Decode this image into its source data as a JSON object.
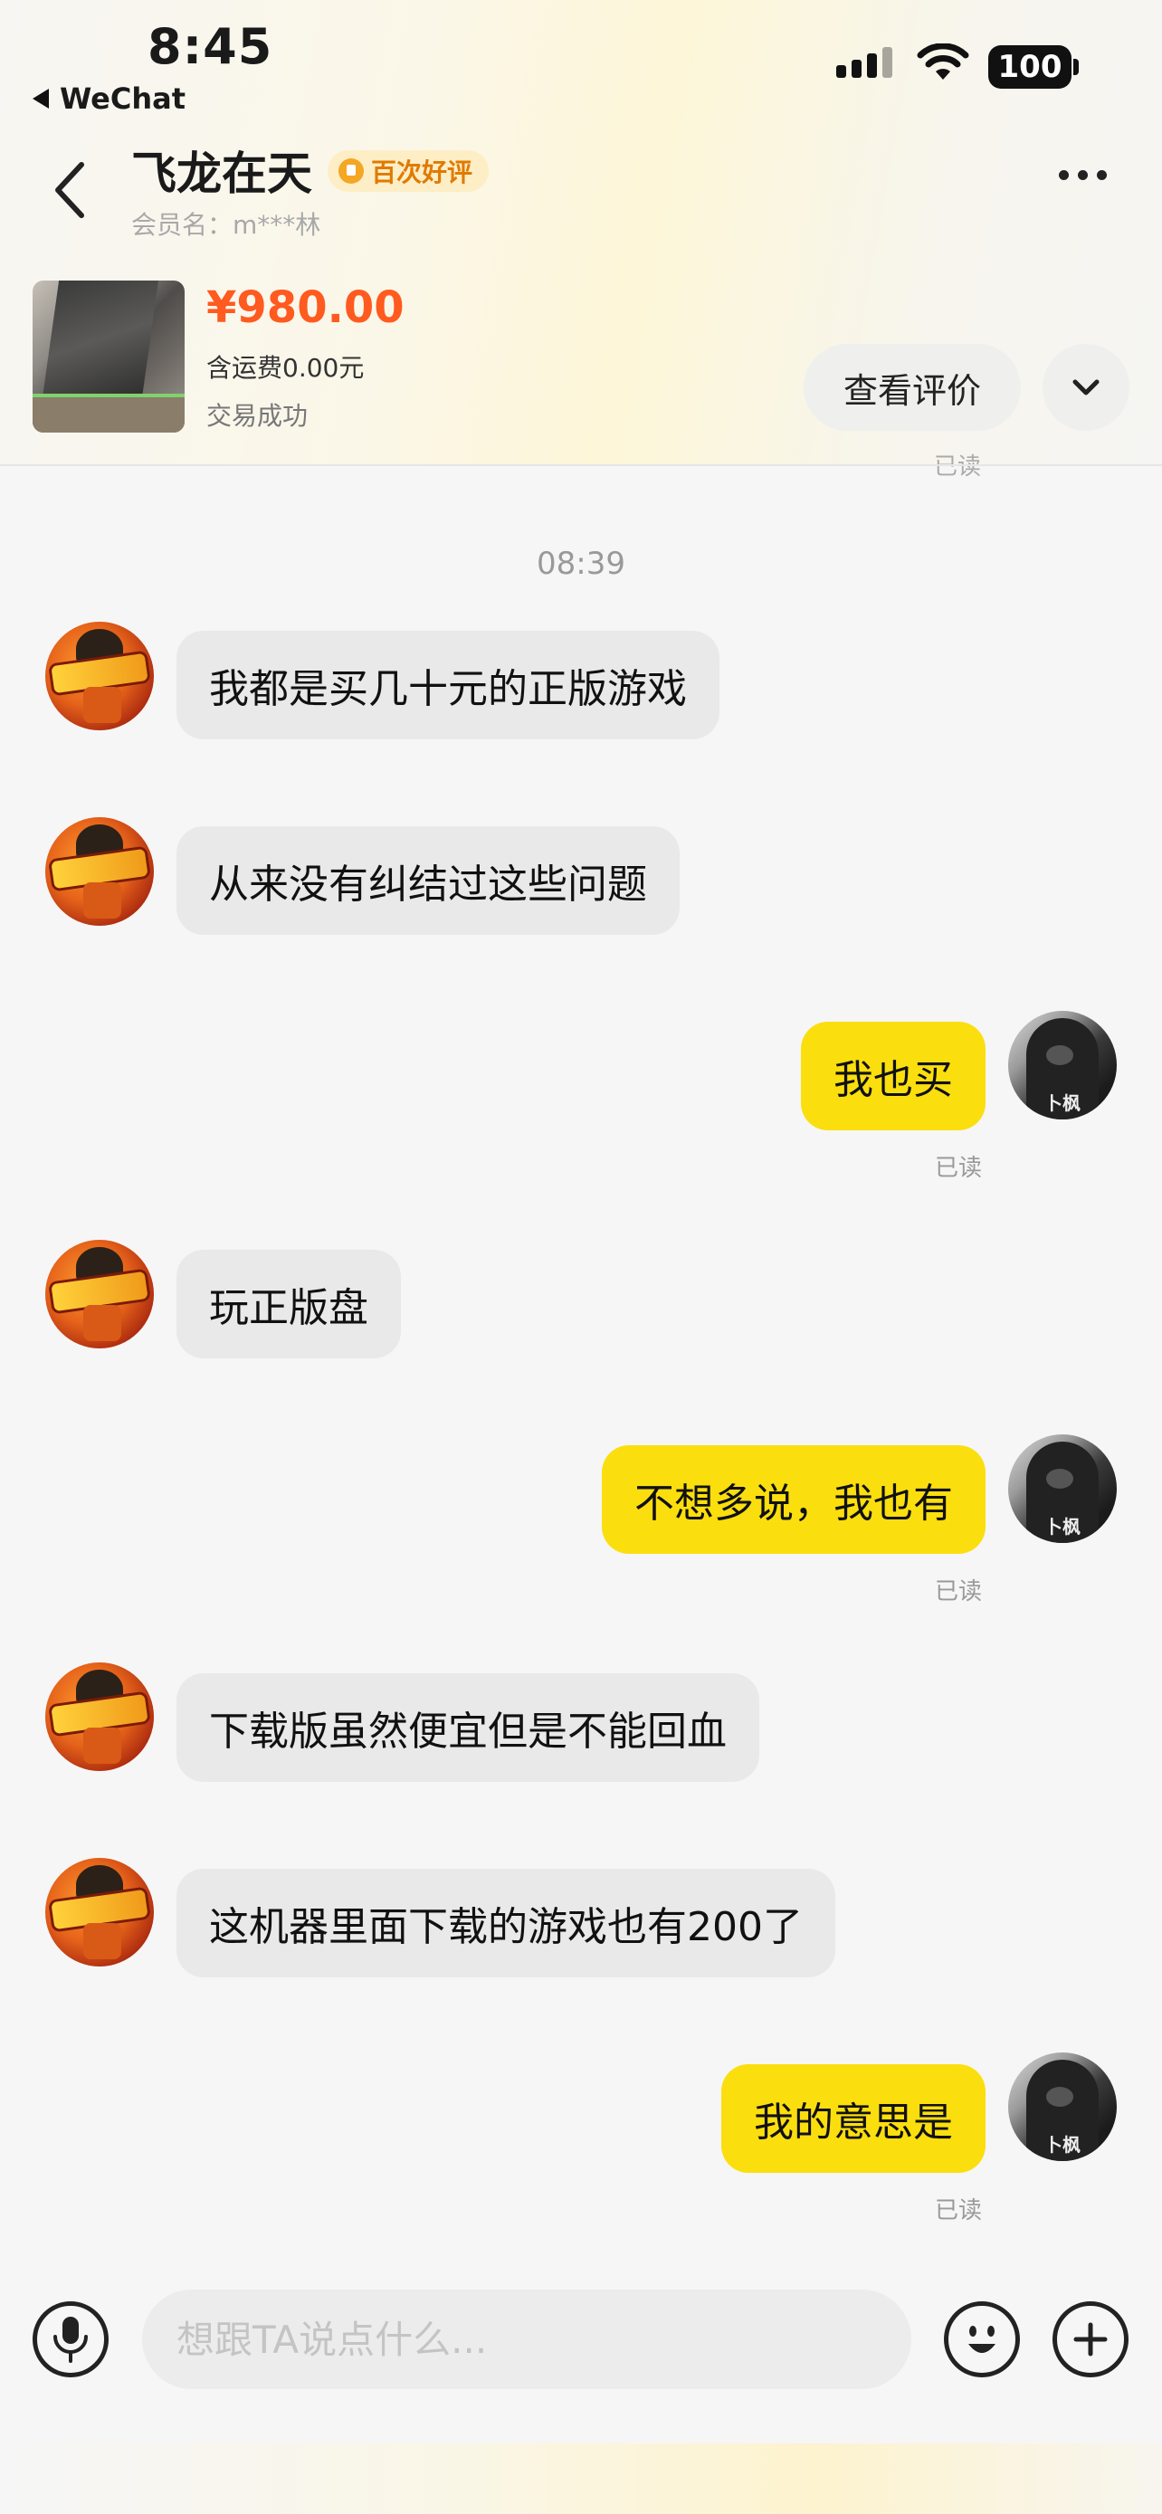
{
  "status_bar": {
    "time": "8:45",
    "back_app": "WeChat",
    "battery": "100"
  },
  "header": {
    "seller_name": "飞龙在天",
    "badge": "百次好评",
    "member_name": "会员名：m***林"
  },
  "product": {
    "price": "¥980.00",
    "shipping": "含运费0.00元",
    "status": "交易成功",
    "review_button": "查看评价"
  },
  "chat": {
    "previous_read": "已读",
    "timestamp": "08:39",
    "messages": [
      {
        "side": "left",
        "text": "我都是买几十元的正版游戏"
      },
      {
        "side": "left",
        "text": "从来没有纠结过这些问题"
      },
      {
        "side": "right",
        "text": "我也买",
        "read": "已读"
      },
      {
        "side": "left",
        "text": "玩正版盘"
      },
      {
        "side": "right",
        "text": "不想多说，我也有",
        "read": "已读"
      },
      {
        "side": "left",
        "text": "下载版虽然便宜但是不能回血"
      },
      {
        "side": "left",
        "text": "这机器里面下载的游戏也有200了"
      },
      {
        "side": "right",
        "text": "我的意思是",
        "read": "已读"
      }
    ]
  },
  "input": {
    "placeholder": "想跟TA说点什么..."
  },
  "colors": {
    "price": "#ff5a1f",
    "own_bubble": "#fbde0e",
    "other_bubble": "#e9e9ea",
    "badge_bg": "#fdeec6",
    "badge_text": "#e07a00"
  },
  "icons": [
    "back-arrow-icon",
    "more-icon",
    "chevron-down-icon",
    "microphone-icon",
    "emoji-icon",
    "plus-icon"
  ]
}
